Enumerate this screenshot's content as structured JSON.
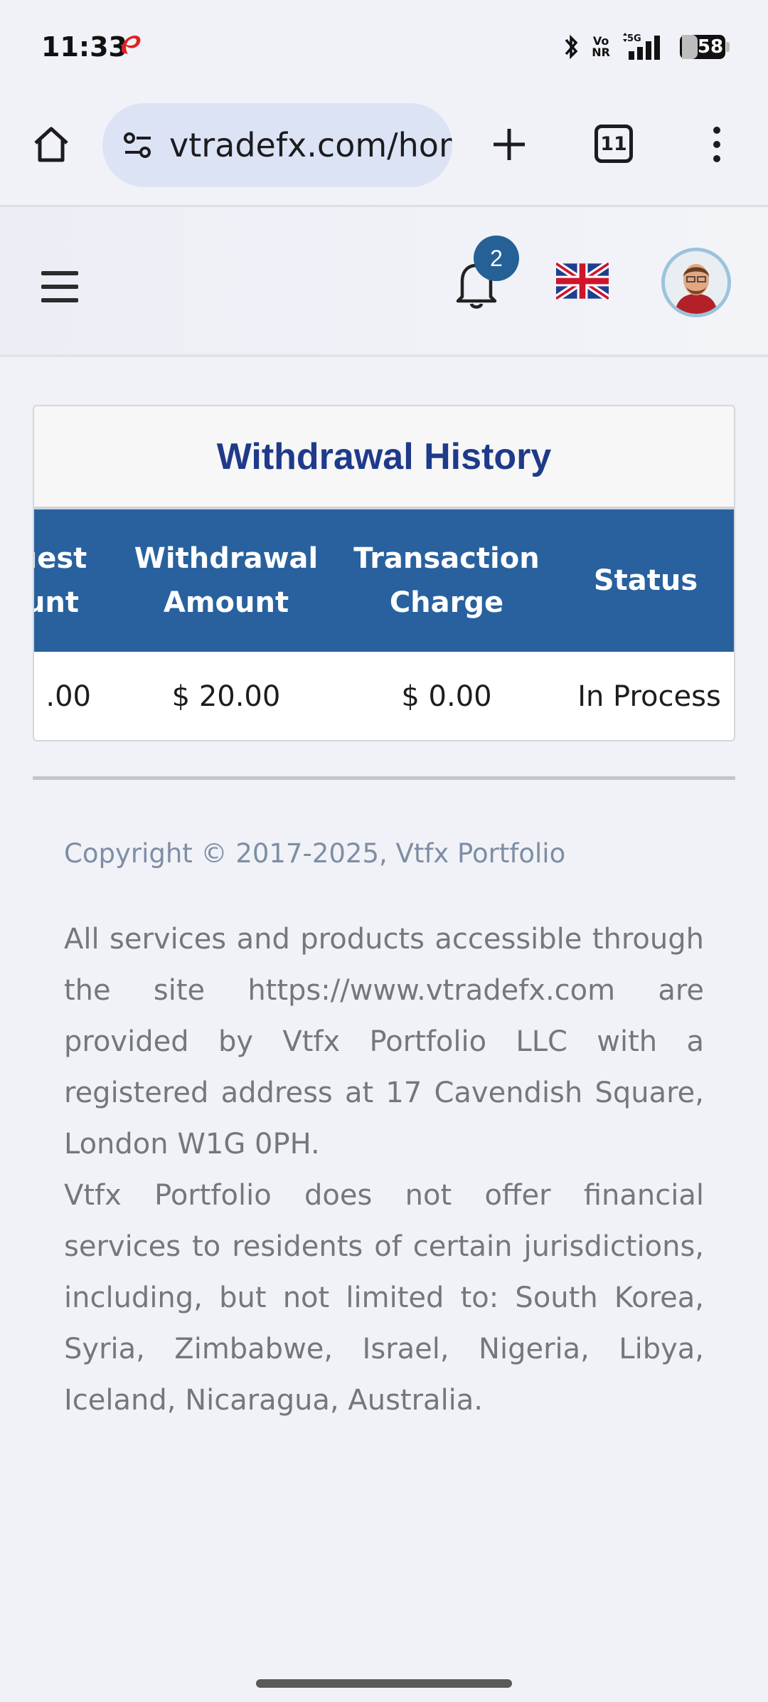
{
  "status_bar": {
    "time": "11:33",
    "battery": "58",
    "network": "5G",
    "volte_line1": "Vo",
    "volte_line2": "NR"
  },
  "browser": {
    "url": "vtradefx.com/hom",
    "tab_count": "11"
  },
  "header": {
    "notification_count": "2"
  },
  "card": {
    "title": "Withdrawal History",
    "columns": [
      "uest\nunt",
      "Withdrawal\nAmount",
      "Transaction\nCharge",
      "Status"
    ],
    "rows": [
      [
        ".00",
        "$ 20.00",
        "$ 0.00",
        "In Process"
      ]
    ]
  },
  "footer": {
    "copyright": "Copyright © 2017-2025, Vtfx Portfolio",
    "paragraph1": "All services and products accessible through the site https://www.vtradefx.com are provided by Vtfx Portfolio LLC with a registered address at 17 Cavendish Square, London W1G 0PH.",
    "paragraph2": "Vtfx Portfolio does not offer financial services to residents of certain jurisdictions, including, but not limited to: South Korea, Syria, Zimbabwe, Israel, Nigeria, Libya, Iceland, Nicaragua, Australia."
  },
  "colors": {
    "accent": "#28619e",
    "title": "#1f3a8a",
    "badge": "#256096",
    "carrier": "#e02020"
  },
  "icons": {
    "carrier": "airtel-logo-icon",
    "bluetooth": "bluetooth-icon",
    "signal": "signal-bars-icon",
    "home": "home-icon",
    "site_info": "tune-icon",
    "new_tab": "plus-icon",
    "more": "more-vertical-icon",
    "menu": "hamburger-icon",
    "notifications": "bell-icon",
    "language": "uk-flag-icon"
  }
}
